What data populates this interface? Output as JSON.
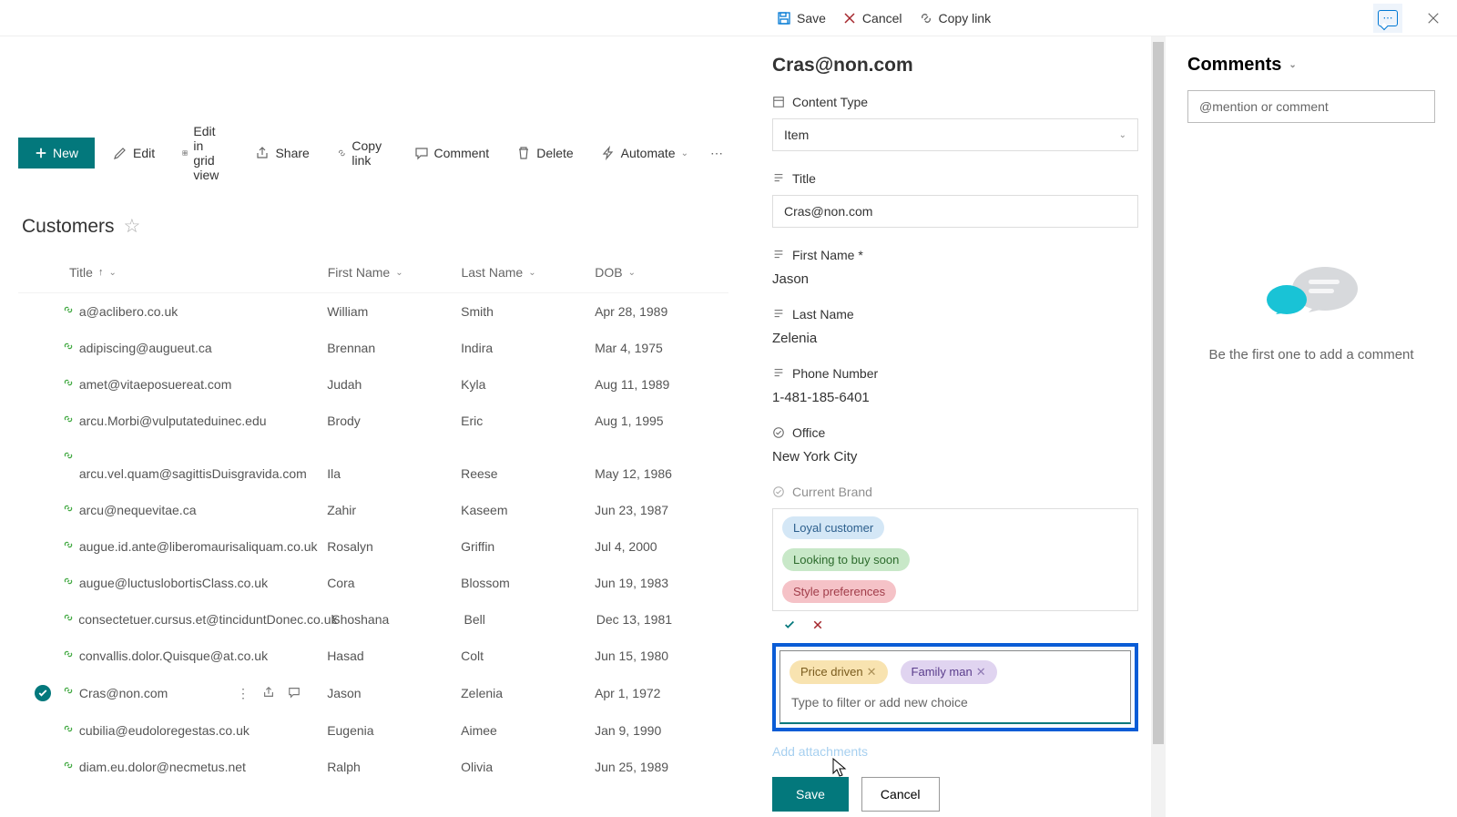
{
  "top": {
    "save": "Save",
    "cancel": "Cancel",
    "copy_link": "Copy link"
  },
  "commands": {
    "new": "New",
    "edit": "Edit",
    "edit_grid": "Edit in grid view",
    "share": "Share",
    "copy_link": "Copy link",
    "comment": "Comment",
    "delete": "Delete",
    "automate": "Automate"
  },
  "list": {
    "title": "Customers",
    "columns": {
      "title": "Title",
      "first_name": "First Name",
      "last_name": "Last Name",
      "dob": "DOB"
    },
    "rows": [
      {
        "title": "a@aclibero.co.uk",
        "fn": "William",
        "ln": "Smith",
        "dob": "Apr 28, 1989"
      },
      {
        "title": "adipiscing@augueut.ca",
        "fn": "Brennan",
        "ln": "Indira",
        "dob": "Mar 4, 1975"
      },
      {
        "title": "amet@vitaeposuereat.com",
        "fn": "Judah",
        "ln": "Kyla",
        "dob": "Aug 11, 1989"
      },
      {
        "title": "arcu.Morbi@vulputateduinec.edu",
        "fn": "Brody",
        "ln": "Eric",
        "dob": "Aug 1, 1995"
      },
      {
        "title": "arcu.vel.quam@sagittisDuisgravida.com",
        "fn": "Ila",
        "ln": "Reese",
        "dob": "May 12, 1986"
      },
      {
        "title": "arcu@nequevitae.ca",
        "fn": "Zahir",
        "ln": "Kaseem",
        "dob": "Jun 23, 1987"
      },
      {
        "title": "augue.id.ante@liberomaurisaliquam.co.uk",
        "fn": "Rosalyn",
        "ln": "Griffin",
        "dob": "Jul 4, 2000"
      },
      {
        "title": "augue@luctuslobortisClass.co.uk",
        "fn": "Cora",
        "ln": "Blossom",
        "dob": "Jun 19, 1983"
      },
      {
        "title": "consectetuer.cursus.et@tinciduntDonec.co.uk",
        "fn": "Shoshana",
        "ln": "Bell",
        "dob": "Dec 13, 1981"
      },
      {
        "title": "convallis.dolor.Quisque@at.co.uk",
        "fn": "Hasad",
        "ln": "Colt",
        "dob": "Jun 15, 1980"
      },
      {
        "title": "Cras@non.com",
        "fn": "Jason",
        "ln": "Zelenia",
        "dob": "Apr 1, 1972",
        "selected": true
      },
      {
        "title": "cubilia@eudoloregestas.co.uk",
        "fn": "Eugenia",
        "ln": "Aimee",
        "dob": "Jan 9, 1990"
      },
      {
        "title": "diam.eu.dolor@necmetus.net",
        "fn": "Ralph",
        "ln": "Olivia",
        "dob": "Jun 25, 1989"
      }
    ]
  },
  "pane": {
    "title": "Cras@non.com",
    "fields": {
      "content_type_label": "Content Type",
      "content_type_value": "Item",
      "title_label": "Title",
      "title_value": "Cras@non.com",
      "first_name_label": "First Name *",
      "first_name_value": "Jason",
      "last_name_label": "Last Name",
      "last_name_value": "Zelenia",
      "phone_label": "Phone Number",
      "phone_value": "1-481-185-6401",
      "office_label": "Office",
      "office_value": "New York City",
      "brand_label": "Current Brand"
    },
    "choices": {
      "loyal": "Loyal customer",
      "looking": "Looking to buy soon",
      "style": "Style preferences",
      "price": "Price driven",
      "family": "Family man"
    },
    "choice_input_placeholder": "Type to filter or add new choice",
    "add_attachments": "Add attachments",
    "save": "Save",
    "cancel": "Cancel"
  },
  "comments": {
    "title": "Comments",
    "input_placeholder": "@mention or comment",
    "empty_text": "Be the first one to add a comment"
  }
}
